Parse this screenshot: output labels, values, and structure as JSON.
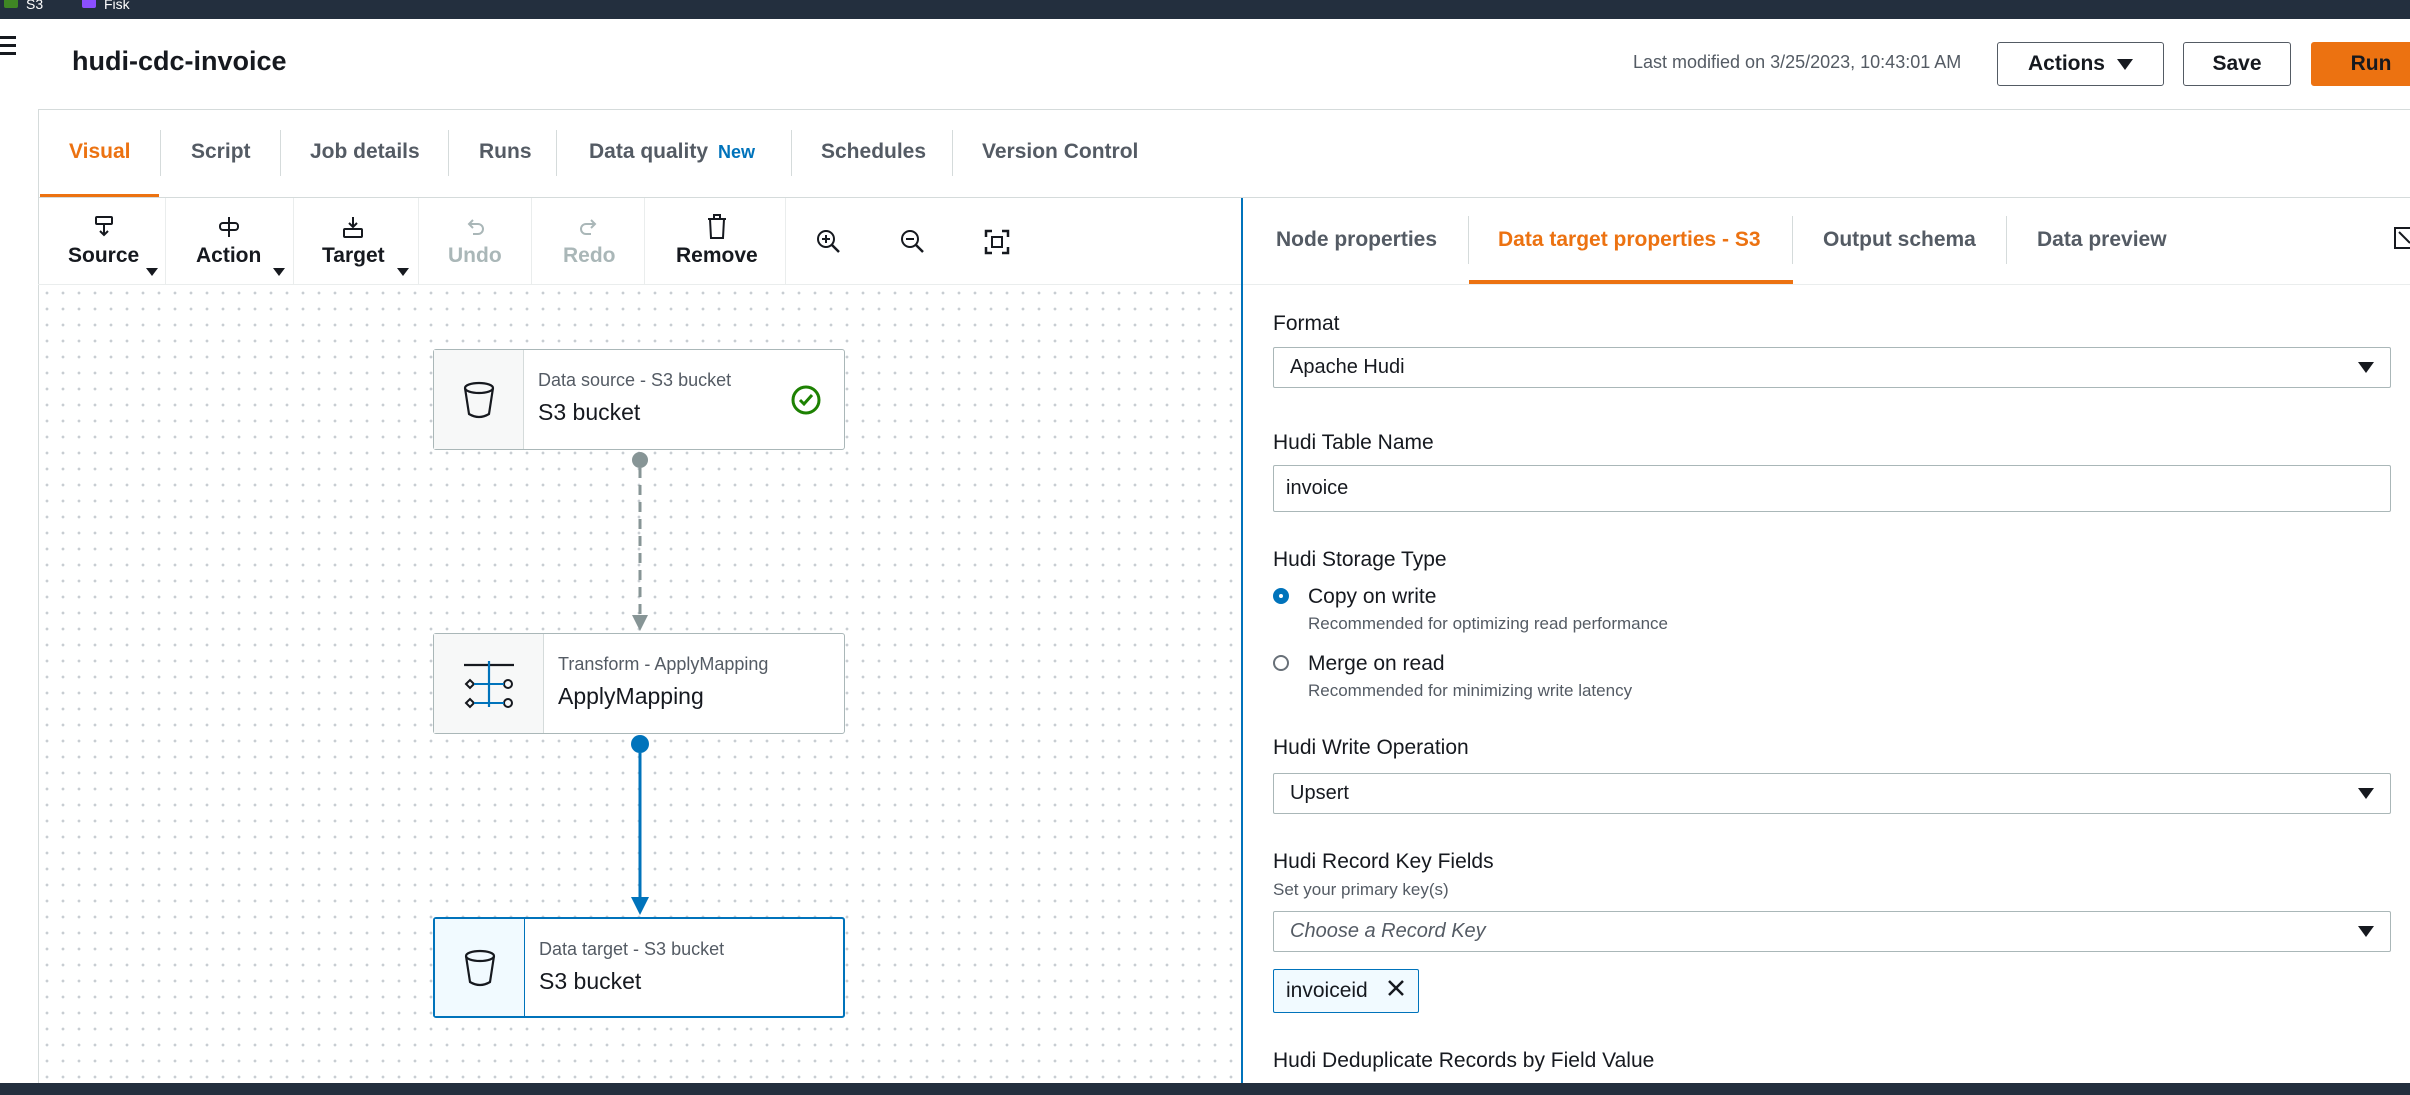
{
  "top_bar": {
    "services": [
      {
        "label": "S3",
        "color": "#3f8624"
      },
      {
        "label": "Fisk",
        "color": "#8c4fff"
      }
    ]
  },
  "header": {
    "title": "hudi-cdc-invoice",
    "last_modified": "Last modified on 3/25/2023, 10:43:01 AM",
    "actions_label": "Actions",
    "save_label": "Save",
    "run_label": "Run"
  },
  "tabs": {
    "visual": "Visual",
    "script": "Script",
    "job_details": "Job details",
    "runs": "Runs",
    "data_quality": "Data quality",
    "data_quality_badge": "New",
    "schedules": "Schedules",
    "version_control": "Version Control",
    "active": "Visual"
  },
  "toolbar": {
    "source": "Source",
    "action": "Action",
    "target": "Target",
    "undo": "Undo",
    "redo": "Redo",
    "remove": "Remove",
    "zoom_in_icon": "zoom-in-icon",
    "zoom_out_icon": "zoom-out-icon",
    "fit_icon": "fit-to-screen-icon"
  },
  "graph": {
    "nodes": [
      {
        "type": "Data source - S3 bucket",
        "name": "S3 bucket",
        "icon": "bucket-icon",
        "status": "check-circle-icon"
      },
      {
        "type": "Transform - ApplyMapping",
        "name": "ApplyMapping",
        "icon": "apply-mapping-icon"
      },
      {
        "type": "Data target - S3 bucket",
        "name": "S3 bucket",
        "icon": "bucket-icon",
        "selected": true
      }
    ]
  },
  "panel": {
    "tabs": {
      "node_properties": "Node properties",
      "data_target": "Data target properties - S3",
      "output_schema": "Output schema",
      "data_preview": "Data preview",
      "active": "Data target properties - S3"
    },
    "format": {
      "label": "Format",
      "value": "Apache Hudi"
    },
    "table_name": {
      "label": "Hudi Table Name",
      "value": "invoice"
    },
    "storage_type": {
      "label": "Hudi Storage Type",
      "options": [
        {
          "label": "Copy on write",
          "description": "Recommended for optimizing read performance",
          "selected": true
        },
        {
          "label": "Merge on read",
          "description": "Recommended for minimizing write latency",
          "selected": false
        }
      ]
    },
    "write_operation": {
      "label": "Hudi Write Operation",
      "value": "Upsert"
    },
    "record_key": {
      "label": "Hudi Record Key Fields",
      "hint": "Set your primary key(s)",
      "placeholder": "Choose a Record Key",
      "tokens": [
        "invoiceid"
      ]
    },
    "dedupe": {
      "label": "Hudi Deduplicate Records by Field Value"
    }
  },
  "colors": {
    "accent": "#ec7211",
    "link": "#0073bb",
    "dark_bar": "#232f3e",
    "success": "#1d8102"
  }
}
